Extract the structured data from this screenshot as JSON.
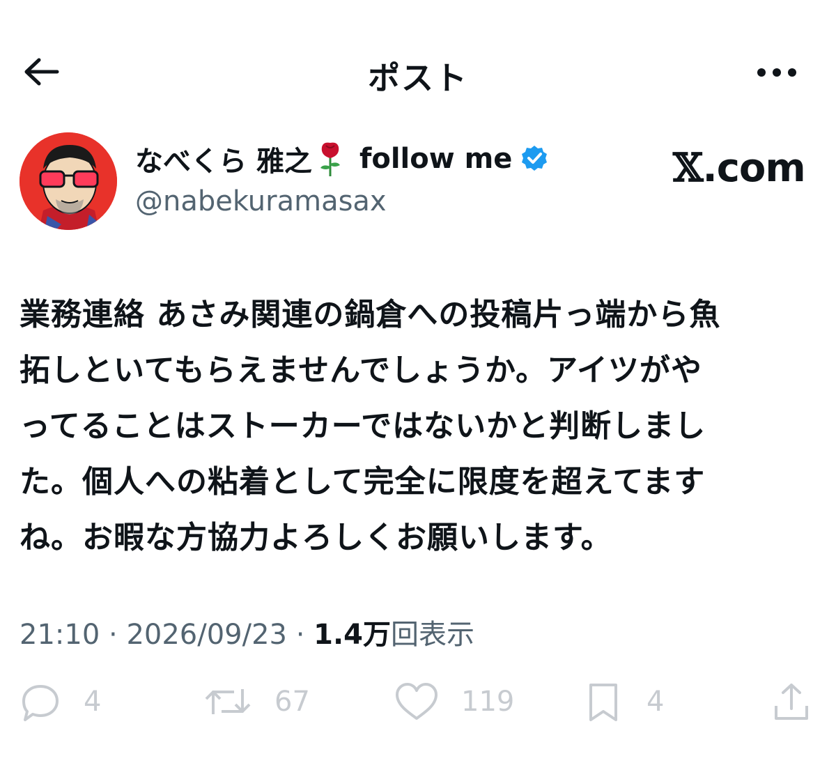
{
  "header": {
    "back_icon": "arrow-left-icon",
    "title": "ポスト",
    "more_icon": "more-horizontal-icon"
  },
  "author": {
    "display_name": "なべくら 雅之",
    "name_emoji": "rose-emoji",
    "name_suffix": "follow me",
    "verified_icon": "verified-badge-icon",
    "verified_color": "#1d9bf0",
    "handle": "@nabekuramasax",
    "avatar_bg": "#e8322a"
  },
  "site_logo": {
    "x": "𝕏",
    "domain": ".com"
  },
  "post": {
    "lines": [
      "業務連絡 あさみ関連の鍋倉への投稿片っ端から魚",
      "拓しといてもらえませんでしょうか。アイツがや",
      "ってることはストーカーではないかと判断しまし",
      "た。個人への粘着として完全に限度を超えてます",
      "ね。お暇な方協力よろしくお願いします。"
    ],
    "time": "21:10",
    "date": "2026/09/23",
    "separator": "·",
    "views_count": "1.4万",
    "views_label": "回表示"
  },
  "actions": {
    "reply": {
      "icon": "reply-icon",
      "count": "4"
    },
    "repost": {
      "icon": "repost-icon",
      "count": "67"
    },
    "like": {
      "icon": "heart-icon",
      "count": "119"
    },
    "bookmark": {
      "icon": "bookmark-icon",
      "count": "4"
    },
    "share": {
      "icon": "share-icon"
    },
    "icon_color": "#c7cbd0"
  }
}
